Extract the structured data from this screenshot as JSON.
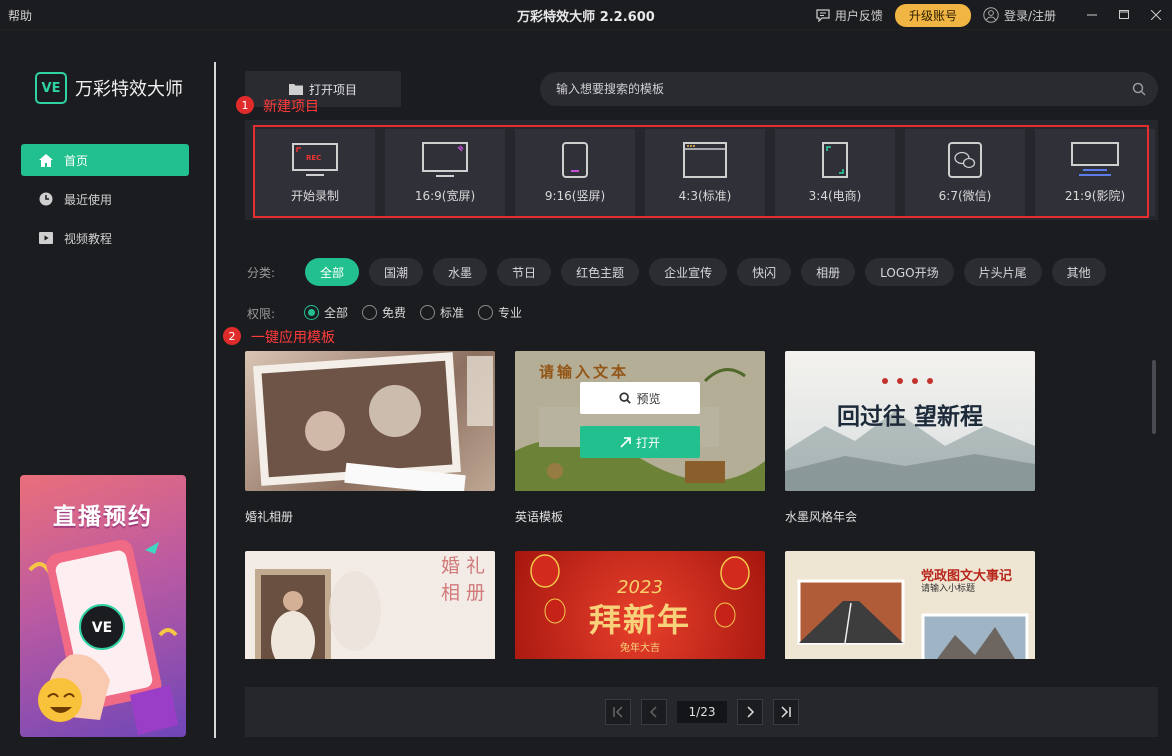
{
  "titlebar": {
    "help": "帮助",
    "title": "万彩特效大师 2.2.600",
    "feedback": "用户反馈",
    "upgrade": "升级账号",
    "login": "登录/注册"
  },
  "colors": {
    "accent": "#22c08f",
    "upgrade": "#f1b543",
    "annotation": "#e52e2e"
  },
  "sidebar": {
    "logo_mark": "VE",
    "logo_text": "万彩特效大师",
    "items": [
      {
        "label": "首页",
        "icon": "home-icon",
        "active": true
      },
      {
        "label": "最近使用",
        "icon": "clock-icon",
        "active": false
      },
      {
        "label": "视频教程",
        "icon": "video-icon",
        "active": false
      }
    ],
    "banner": {
      "title": "直播预约",
      "badge": "VE"
    }
  },
  "toolbar": {
    "open_project": "打开项目",
    "search_placeholder": "输入想要搜索的模板"
  },
  "annotations": [
    {
      "num": "1",
      "text": "新建项目"
    },
    {
      "num": "2",
      "text": "一键应用模板"
    }
  ],
  "aspects": [
    {
      "label": "开始录制",
      "icon": "rec-icon"
    },
    {
      "label": "16:9(宽屏)",
      "icon": "widescreen-icon"
    },
    {
      "label": "9:16(竖屏)",
      "icon": "portrait-icon"
    },
    {
      "label": "4:3(标准)",
      "icon": "standard-icon"
    },
    {
      "label": "3:4(电商)",
      "icon": "ecommerce-icon"
    },
    {
      "label": "6:7(微信)",
      "icon": "wechat-icon"
    },
    {
      "label": "21:9(影院)",
      "icon": "cinema-icon"
    }
  ],
  "categories": {
    "label": "分类:",
    "items": [
      "全部",
      "国潮",
      "水墨",
      "节日",
      "红色主题",
      "企业宣传",
      "快闪",
      "相册",
      "LOGO开场",
      "片头片尾",
      "其他"
    ],
    "selected": "全部"
  },
  "permissions": {
    "label": "权限:",
    "items": [
      "全部",
      "免费",
      "标准",
      "专业"
    ],
    "selected": "全部"
  },
  "templates": [
    {
      "title": "婚礼相册"
    },
    {
      "title": "英语模板",
      "thumb_text": "请输入文本",
      "preview": "预览",
      "open": "打开"
    },
    {
      "title": "水墨风格年会",
      "thumb_text": "回过往 望新程"
    },
    {
      "title": "",
      "thumb_text": "婚礼相册"
    },
    {
      "title": "",
      "thumb_text": "拜新年",
      "year": "2023",
      "sub": "兔年大吉"
    },
    {
      "title": "",
      "thumb_text": "党政图文大事记",
      "sub": "请输入小标题"
    }
  ],
  "pager": {
    "current": "1/23"
  }
}
